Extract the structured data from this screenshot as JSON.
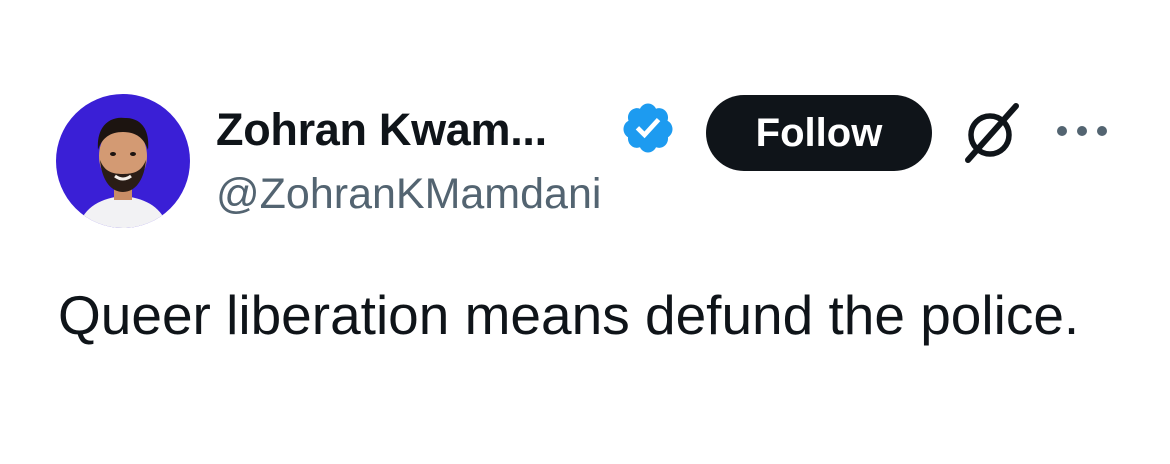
{
  "post": {
    "author": {
      "display_name": "Zohran Kwam...",
      "handle": "@ZohranKMamdani",
      "verified": true,
      "verified_color": "#1d9bf0",
      "avatar_background": "#3a1fd6"
    },
    "follow_button": {
      "label": "Follow",
      "background": "#0f1419",
      "text_color": "#ffffff"
    },
    "icons": {
      "grok": "grok-icon",
      "more": "more-options-icon",
      "verified": "verified-badge-icon"
    },
    "text": "Queer liberation means defund the police."
  }
}
